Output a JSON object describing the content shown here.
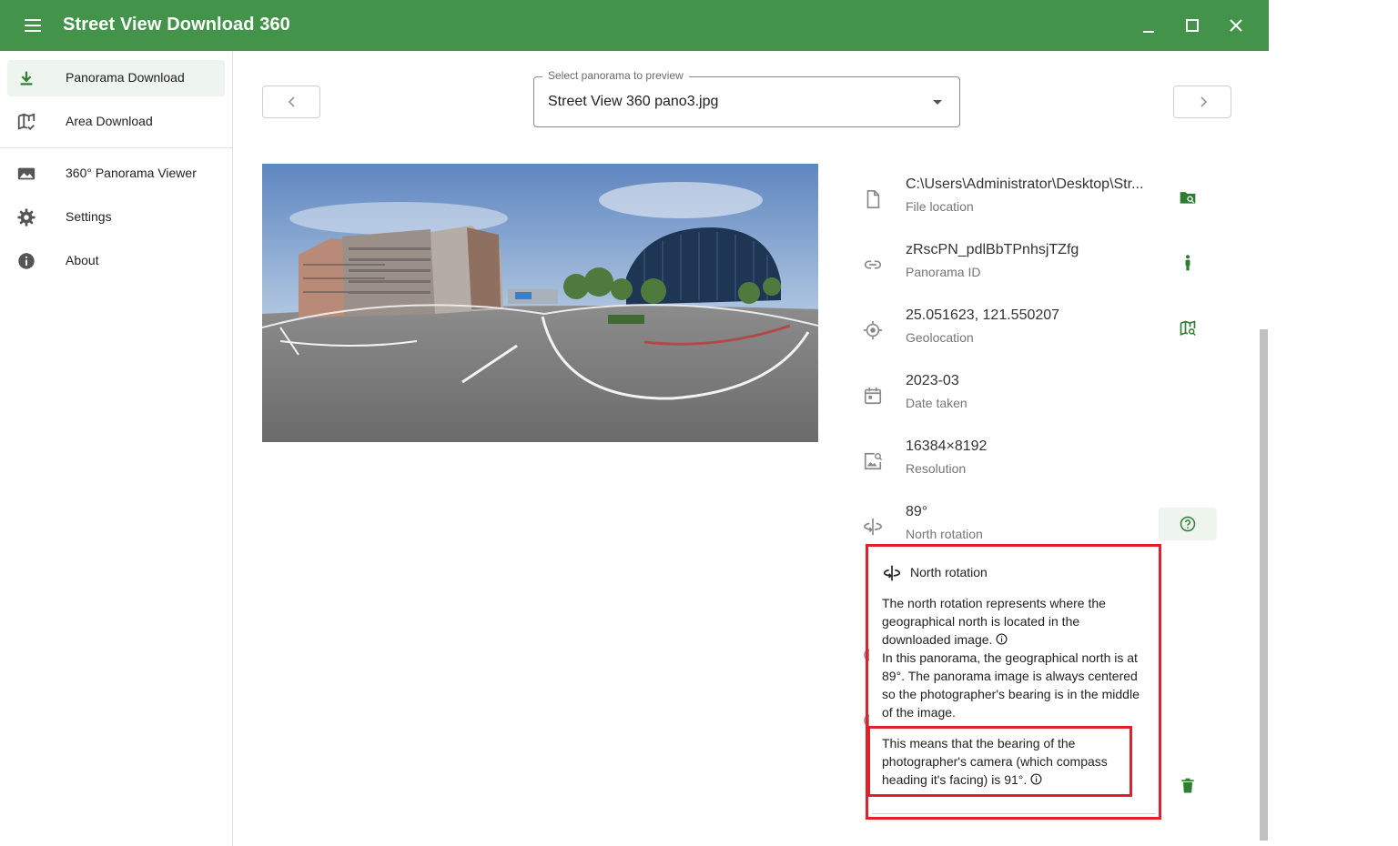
{
  "app": {
    "title": "Street View Download 360"
  },
  "sidebar": {
    "items": [
      {
        "label": "Panorama Download",
        "icon": "download-icon",
        "active": true
      },
      {
        "label": "Area Download",
        "icon": "map-check-icon"
      },
      {
        "label": "360° Panorama Viewer",
        "icon": "image-icon"
      },
      {
        "label": "Settings",
        "icon": "gear-icon"
      },
      {
        "label": "About",
        "icon": "info-icon"
      }
    ]
  },
  "selector": {
    "label": "Select panorama to preview",
    "value": "Street View 360 pano3.jpg"
  },
  "details": {
    "file": {
      "value": "C:\\Users\\Administrator\\Desktop\\Str...",
      "label": "File location"
    },
    "pano_id": {
      "value": "zRscPN_pdlBbTPnhsjTZfg",
      "label": "Panorama ID"
    },
    "geo": {
      "value": "25.051623, 121.550207",
      "label": "Geolocation"
    },
    "date": {
      "value": "2023-03",
      "label": "Date taken"
    },
    "resolution": {
      "value": "16384×8192",
      "label": "Resolution"
    },
    "rotation": {
      "value": "89°",
      "label": "North rotation"
    }
  },
  "popup": {
    "title": "North rotation",
    "para1": "The north rotation represents where the geographical north is located in the downloaded image.",
    "para2": "In this panorama, the geographical north is at 89°. The panorama image is always centered so the photographer's bearing is in the middle of the image.",
    "para3": "This means that the bearing of the photographer's camera (which compass heading it's facing) is 91°."
  },
  "colors": {
    "appbar": "#43944a",
    "accent": "#2e7d32",
    "highlight": "#e0202a"
  }
}
